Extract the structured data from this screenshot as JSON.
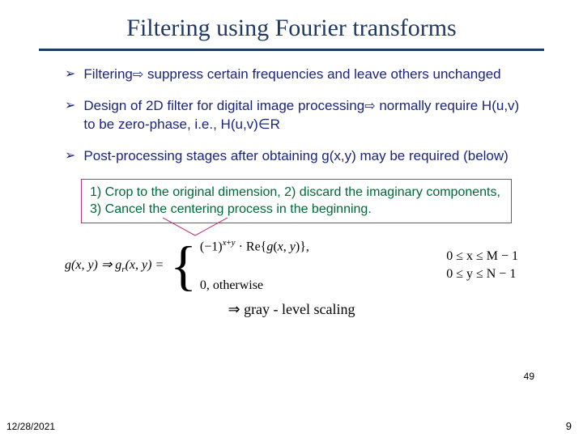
{
  "title": "Filtering using Fourier transforms",
  "bullets": [
    {
      "marker": "➢",
      "pre": "Filtering",
      "arrow": "⇨",
      "post": " suppress certain frequencies and leave others unchanged"
    },
    {
      "marker": "➢",
      "pre": "Design of 2D filter for digital image processing",
      "arrow": "⇨",
      "post": " normally require H(u,v) to be zero-phase, i.e., H(u,v)∈R"
    },
    {
      "marker": "➢",
      "pre": "Post-processing stages after obtaining g(x,y) may be required (below)",
      "arrow": "",
      "post": ""
    }
  ],
  "box": {
    "text": "1) Crop to the original dimension, 2) discard the imaginary components, 3) Cancel the centering process in the beginning."
  },
  "equation": {
    "left": "g(x, y) ⇒ gᵣ(x, y) =",
    "case_top": "(−1) x + y · Re{ g(x, y) },",
    "case_bot": "0, otherwise",
    "range1": "0 ≤ x ≤ M − 1",
    "range2": "0 ≤ y ≤ N − 1",
    "gray": "⇒ gray - level scaling"
  },
  "inner_page": "49",
  "footer": {
    "date": "12/28/2021",
    "page": "9"
  }
}
